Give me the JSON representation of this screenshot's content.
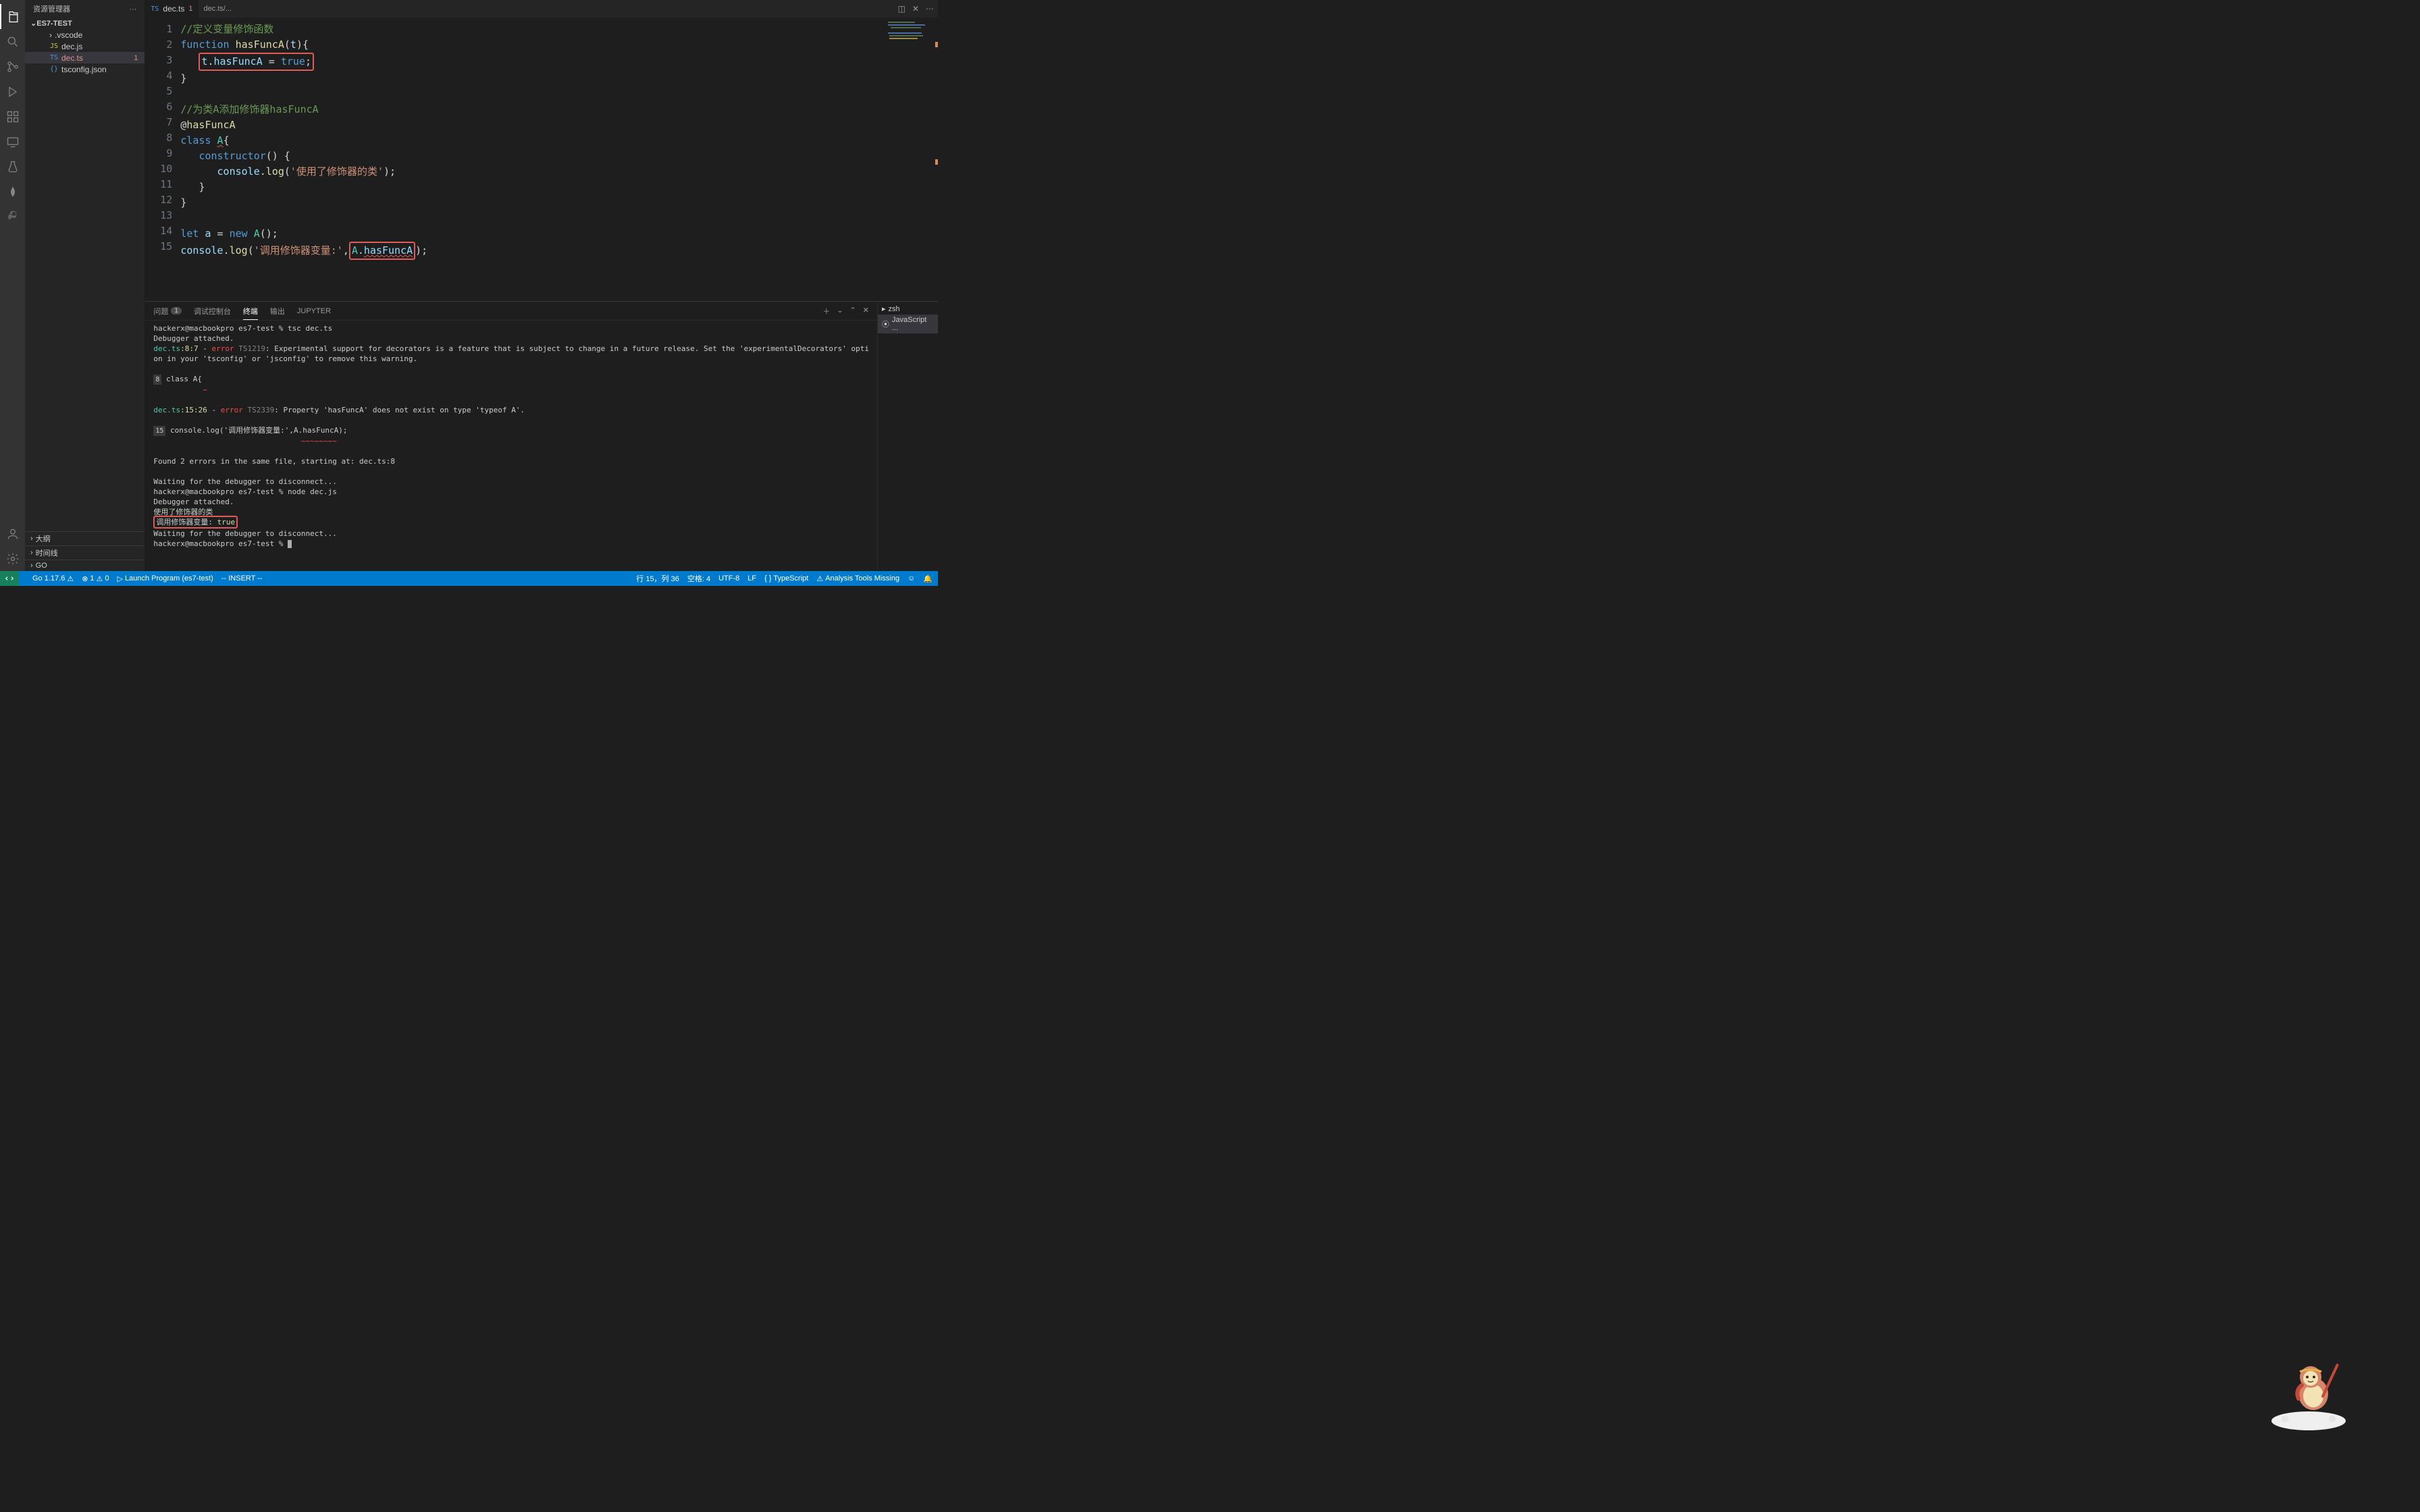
{
  "sidebar": {
    "title": "资源管理器",
    "root": "ES7-TEST",
    "items": [
      {
        "label": ".vscode",
        "kind": "folder"
      },
      {
        "label": "dec.js",
        "kind": "js"
      },
      {
        "label": "dec.ts",
        "kind": "ts",
        "badge": "1",
        "selected": true,
        "error": true
      },
      {
        "label": "tsconfig.json",
        "kind": "json"
      }
    ],
    "sections": [
      {
        "label": "大纲"
      },
      {
        "label": "时间线"
      },
      {
        "label": "GO"
      }
    ]
  },
  "tabs": {
    "active": {
      "icon": "TS",
      "name": "dec.ts",
      "warn": "1"
    },
    "breadcrumb": "dec.ts/..."
  },
  "editor": {
    "lines": [
      {
        "type": "comment",
        "text": "//定义变量修饰函数"
      },
      {
        "type": "func_def"
      },
      {
        "type": "func_body_hl"
      },
      {
        "type": "close_brace"
      },
      {
        "type": "blank"
      },
      {
        "type": "comment",
        "text": "//为类A添加修饰器hasFuncA"
      },
      {
        "type": "decorator"
      },
      {
        "type": "class_def"
      },
      {
        "type": "ctor_open"
      },
      {
        "type": "ctor_body"
      },
      {
        "type": "ctor_close"
      },
      {
        "type": "close_brace"
      },
      {
        "type": "blank"
      },
      {
        "type": "let_a"
      },
      {
        "type": "console_hl"
      }
    ],
    "strings": {
      "hasFuncA": "hasFuncA",
      "t": "t",
      "true_kw": "true",
      "class": "class",
      "A": "A",
      "constructor": "constructor",
      "console": "console",
      "log": "log",
      "str_used": "'使用了修饰器的类'",
      "let": "let",
      "a": "a",
      "new": "new",
      "str_call": "'调用修饰器变量:'",
      "function": "function"
    }
  },
  "panel": {
    "tabs": [
      "问题",
      "调试控制台",
      "终端",
      "输出",
      "JUPYTER"
    ],
    "active_tab": "终端",
    "problem_count": "1",
    "side": [
      {
        "label": "zsh",
        "icon": "shell"
      },
      {
        "label": "JavaScript ...",
        "icon": "debug"
      }
    ],
    "terminal_lines": [
      {
        "t": "prompt",
        "text": "hackerx@macbookpro es7-test % tsc dec.ts"
      },
      {
        "t": "plain",
        "text": "Debugger attached."
      },
      {
        "t": "err_hdr1"
      },
      {
        "t": "plain",
        "text": "on in your 'tsconfig' or 'jsconfig' to remove this warning."
      },
      {
        "t": "blank"
      },
      {
        "t": "code_ln",
        "ln": "8",
        "text": " class A{"
      },
      {
        "t": "squig",
        "pad": "        ",
        "text": "~"
      },
      {
        "t": "blank"
      },
      {
        "t": "err_hdr2"
      },
      {
        "t": "blank"
      },
      {
        "t": "code_ln",
        "ln": "15",
        "text": " console.log('调用修饰器变量:',A.hasFuncA);"
      },
      {
        "t": "squig",
        "pad": "                              ",
        "text": "~~~~~~~~"
      },
      {
        "t": "blank"
      },
      {
        "t": "plain",
        "text": "Found 2 errors in the same file, starting at: dec.ts:8"
      },
      {
        "t": "blank"
      },
      {
        "t": "plain",
        "text": "Waiting for the debugger to disconnect..."
      },
      {
        "t": "prompt",
        "text": "hackerx@macbookpro es7-test % node dec.js"
      },
      {
        "t": "plain",
        "text": "Debugger attached."
      },
      {
        "t": "plain",
        "text": "使用了修饰器的类"
      },
      {
        "t": "out_hl"
      },
      {
        "t": "plain",
        "text": "Waiting for the debugger to disconnect..."
      },
      {
        "t": "prompt_cursor",
        "text": "hackerx@macbookpro es7-test % "
      }
    ],
    "err1": {
      "file": "dec.ts",
      "loc": ":8:7",
      "sep": " - ",
      "kw": "error",
      "code": " TS1219",
      "msg": ": Experimental support for decorators is a feature that is subject to change in a future release. Set the 'experimentalDecorators' opti"
    },
    "err2": {
      "file": "dec.ts",
      "loc": ":15:26",
      "sep": " - ",
      "kw": "error",
      "code": " TS2339",
      "msg": ": Property 'hasFuncA' does not exist on type 'typeof A'."
    },
    "out_hl": {
      "label": "调用修饰器变量: ",
      "val": "true"
    }
  },
  "status": {
    "go": "Go 1.17.6",
    "errors": "1",
    "warnings": "0",
    "launch": "Launch Program (es7-test)",
    "vim": "-- INSERT --",
    "pos": "行 15，列 36",
    "spaces": "空格: 4",
    "encoding": "UTF-8",
    "eol": "LF",
    "lang": "{ } TypeScript",
    "analysis": "Analysis Tools Missing"
  }
}
